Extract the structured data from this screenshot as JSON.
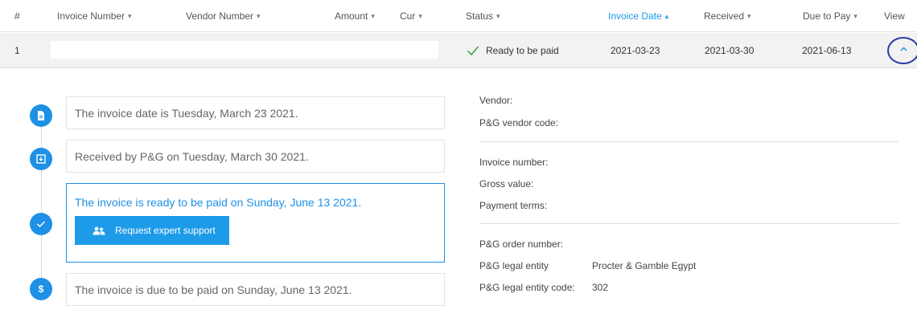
{
  "table": {
    "headers": {
      "index": "#",
      "invoice_number": "Invoice Number",
      "vendor_number": "Vendor Number",
      "amount": "Amount",
      "currency": "Cur",
      "status": "Status",
      "invoice_date": "Invoice Date",
      "received": "Received",
      "due_to_pay": "Due to Pay",
      "view": "View"
    },
    "sort_desc_glyph": "▾",
    "sort_asc_glyph": "▴",
    "row": {
      "index": "1",
      "status": "Ready to be paid",
      "invoice_date": "2021-03-23",
      "received": "2021-03-30",
      "due_to_pay": "2021-06-13"
    }
  },
  "timeline": [
    {
      "icon": "document-icon",
      "text": "The invoice date is Tuesday, March 23 2021."
    },
    {
      "icon": "inbox-icon",
      "text": "Received by P&G on Tuesday, March 30 2021."
    },
    {
      "icon": "check-icon",
      "text": "The invoice is ready to be paid on Sunday, June 13 2021.",
      "button": "Request expert support"
    },
    {
      "icon": "dollar-icon",
      "text": "The invoice is due to be paid on Sunday, June 13 2021."
    }
  ],
  "details": {
    "vendor_label": "Vendor:",
    "vendor_code_label": "P&G vendor code:",
    "invoice_number_label": "Invoice number:",
    "gross_value_label": "Gross value:",
    "payment_terms_label": "Payment terms:",
    "order_number_label": "P&G order number:",
    "legal_entity_label": "P&G legal entity",
    "legal_entity_value": "Procter & Gamble Egypt",
    "legal_entity_code_label": "P&G legal entity code:",
    "legal_entity_code_value": "302"
  },
  "colors": {
    "accent": "#1e90e6",
    "toggle_ring": "#2b3aa8",
    "row_bg": "#f2f2f2",
    "check": "#3aa142"
  }
}
